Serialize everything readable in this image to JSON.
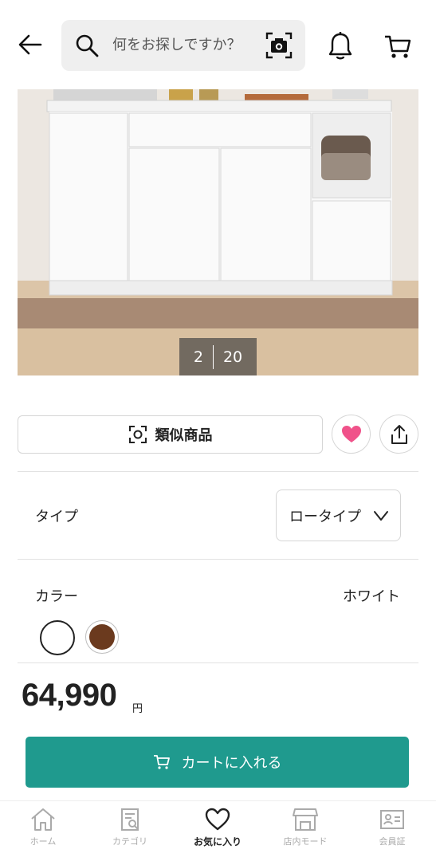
{
  "header": {
    "search_placeholder": "何をお探しですか？"
  },
  "gallery": {
    "current": "2",
    "total": "20"
  },
  "actions": {
    "similar_label": "類似商品"
  },
  "options": {
    "type_label": "タイプ",
    "type_value": "ロータイプ",
    "color_label": "カラー",
    "color_value": "ホワイト",
    "swatches": [
      "#ffffff",
      "#6b3a1e"
    ]
  },
  "price": {
    "value": "64,990",
    "currency": "円"
  },
  "cart_button": {
    "label": "カートに入れる"
  },
  "bottom_nav": {
    "items": [
      {
        "label": "ホーム"
      },
      {
        "label": "カテゴリ"
      },
      {
        "label": "お気に入り"
      },
      {
        "label": "店内モード"
      },
      {
        "label": "会員証"
      }
    ]
  },
  "colors": {
    "accent": "#1f9a8e",
    "favorite": "#f0528a"
  }
}
